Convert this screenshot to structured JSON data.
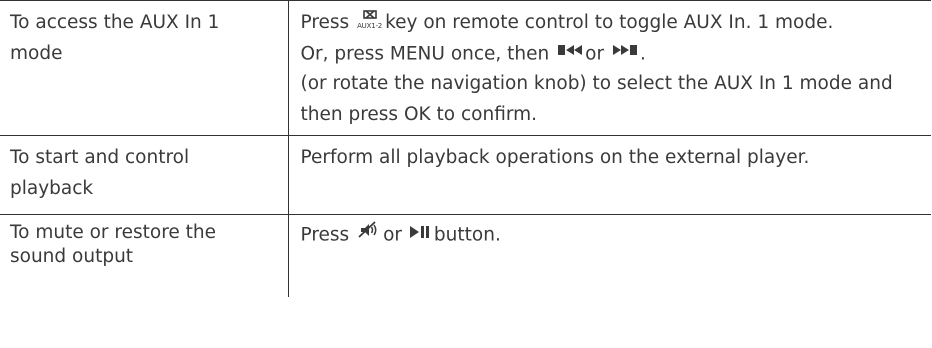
{
  "rows": [
    {
      "action": "To access the AUX In 1 mode",
      "desc": {
        "press_prefix": "Press",
        "aux_icon_label": "AUX1-2",
        "line1_rest": "key on remote control to toggle AUX In. 1 mode.",
        "line2_prefix": "Or, press MENU once, then",
        "line2_or": "or",
        "line2_end": ".",
        "line3": "(or rotate the navigation knob) to select the AUX In 1 mode and then press OK to confirm."
      }
    },
    {
      "action": "To start and control playback",
      "desc": {
        "text": "Perform all playback operations on the external player."
      }
    },
    {
      "action": "To mute or restore the sound output",
      "desc": {
        "press_prefix": "Press",
        "or": "or",
        "suffix": "button."
      }
    }
  ],
  "icons": {
    "aux": "aux-source-icon",
    "prev": "skip-previous-icon",
    "next": "skip-next-icon",
    "mute": "mute-icon",
    "playpause": "play-pause-icon"
  },
  "colors": {
    "text": "#3a3a3a",
    "rule": "#333333"
  }
}
